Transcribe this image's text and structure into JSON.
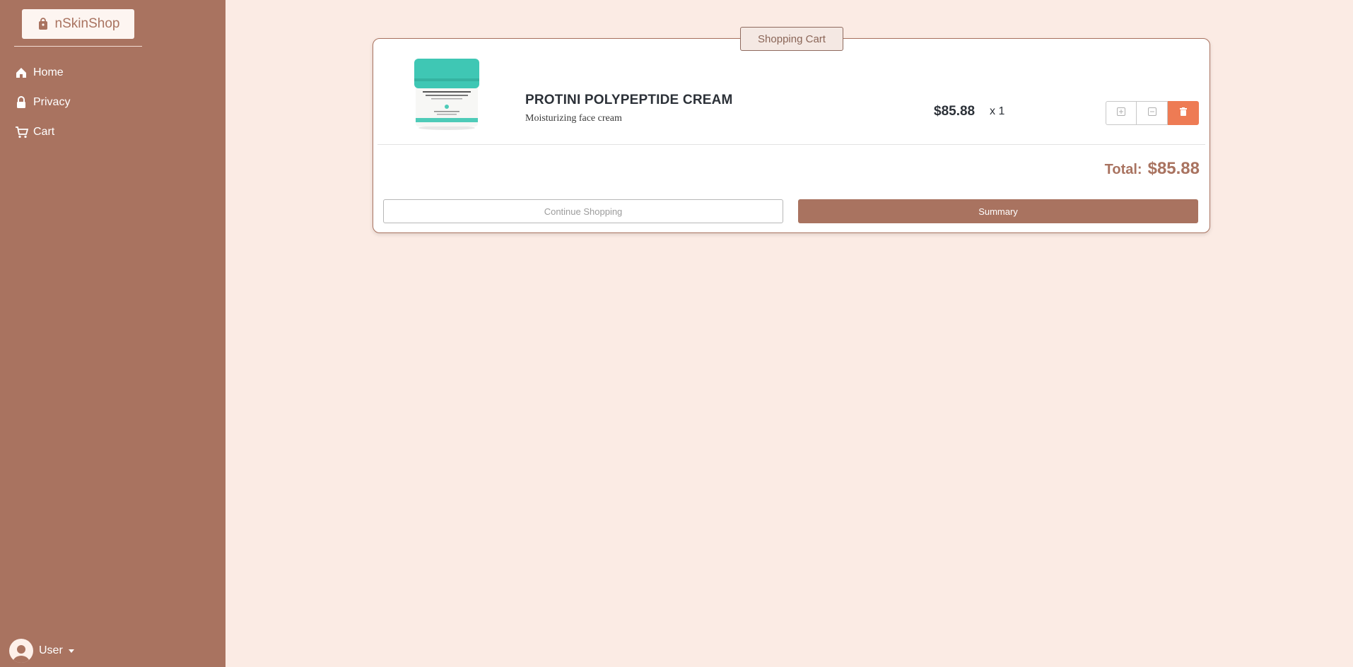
{
  "sidebar": {
    "brand": {
      "label": "nSkinShop",
      "icon": "shopping-bag-icon"
    },
    "nav": [
      {
        "label": "Home",
        "icon": "house-icon"
      },
      {
        "label": "Privacy",
        "icon": "lock-icon"
      },
      {
        "label": "Cart",
        "icon": "cart-icon"
      }
    ],
    "user": {
      "label": "User",
      "icon": "user-avatar-icon"
    }
  },
  "cart": {
    "heading": "Shopping Cart",
    "items": [
      {
        "name": "PROTINI POLYPEPTIDE CREAM",
        "description": "Moisturizing face cream",
        "price": "$85.88",
        "quantity": "x 1",
        "image_label": "Protini Polypeptide Cream"
      }
    ],
    "total_label": "Total:",
    "total_value": "$85.88",
    "continue_label": "Continue Shopping",
    "summary_label": "Summary"
  },
  "colors": {
    "accent": "#a97360",
    "background": "#fbebe4",
    "delete": "#ee7b54"
  }
}
